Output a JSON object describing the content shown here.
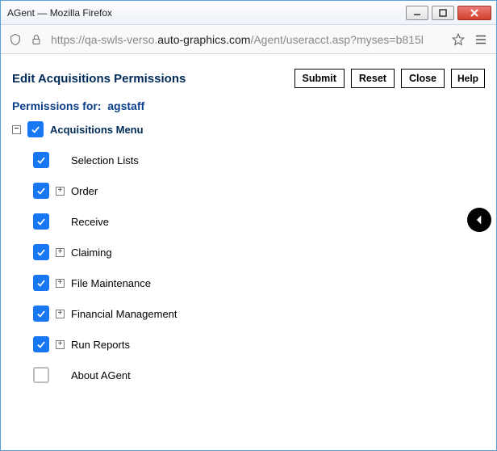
{
  "window": {
    "title": "AGent — Mozilla Firefox"
  },
  "address": {
    "url_prefix": "https://qa-swls-verso.",
    "url_dark": "auto-graphics.com",
    "url_suffix": "/Agent/useracct.asp?myses=b815l"
  },
  "page": {
    "title": "Edit Acquisitions Permissions",
    "permissions_for_label": "Permissions for:",
    "permissions_for_value": "agstaff"
  },
  "buttons": {
    "submit": "Submit",
    "reset": "Reset",
    "close": "Close",
    "help": "Help"
  },
  "tree": {
    "root": {
      "label": "Acquisitions Menu",
      "checked": true,
      "expanded": true
    },
    "items": [
      {
        "label": "Selection Lists",
        "checked": true,
        "expandable": false
      },
      {
        "label": "Order",
        "checked": true,
        "expandable": true
      },
      {
        "label": "Receive",
        "checked": true,
        "expandable": false
      },
      {
        "label": "Claiming",
        "checked": true,
        "expandable": true
      },
      {
        "label": "File Maintenance",
        "checked": true,
        "expandable": true
      },
      {
        "label": "Financial Management",
        "checked": true,
        "expandable": true
      },
      {
        "label": "Run Reports",
        "checked": true,
        "expandable": true
      },
      {
        "label": "About AGent",
        "checked": false,
        "expandable": false
      }
    ]
  }
}
